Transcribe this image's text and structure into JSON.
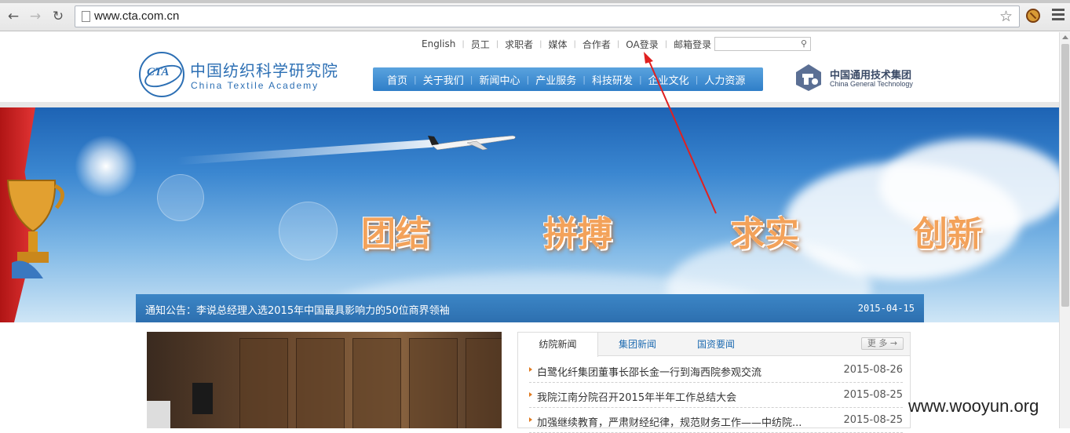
{
  "browser": {
    "url": "www.cta.com.cn",
    "back_icon": "back-arrow-icon",
    "forward_icon": "forward-arrow-icon",
    "reload_icon": "reload-icon"
  },
  "topnav": {
    "items": [
      "English",
      "员工",
      "求职者",
      "媒体",
      "合作者",
      "OA登录",
      "邮箱登录"
    ]
  },
  "logo": {
    "mark": "CTA",
    "cn": "中国纺织科学研究院",
    "en": "China Textile Academy"
  },
  "mainnav": {
    "items": [
      "首页",
      "关于我们",
      "新闻中心",
      "产业服务",
      "科技研发",
      "企业文化",
      "人力资源"
    ]
  },
  "partner": {
    "cn": "中国通用技术集团",
    "en": "China General Technology"
  },
  "banner": {
    "slogans": [
      "团结",
      "拼搏",
      "求实",
      "创新"
    ]
  },
  "notice": {
    "text": "通知公告：李说总经理入选2015年中国最具影响力的50位商界领袖",
    "date": "2015-04-15"
  },
  "news": {
    "tabs": [
      "纺院新闻",
      "集团新闻",
      "国资要闻"
    ],
    "more": "更 多 →",
    "items": [
      {
        "title": "白鹭化纤集团董事长邵长金一行到海西院参观交流",
        "date": "2015-08-26"
      },
      {
        "title": "我院江南分院召开2015年半年工作总结大会",
        "date": "2015-08-25"
      },
      {
        "title": "加强继续教育，严肃财经纪律，规范财务工作——中纺院...",
        "date": "2015-08-25"
      }
    ]
  },
  "watermark": "www.wooyun.org",
  "colors": {
    "nav_blue": "#2f7ec8",
    "annotation_red": "#e02020",
    "slogan_orange": "#f3a25a"
  }
}
